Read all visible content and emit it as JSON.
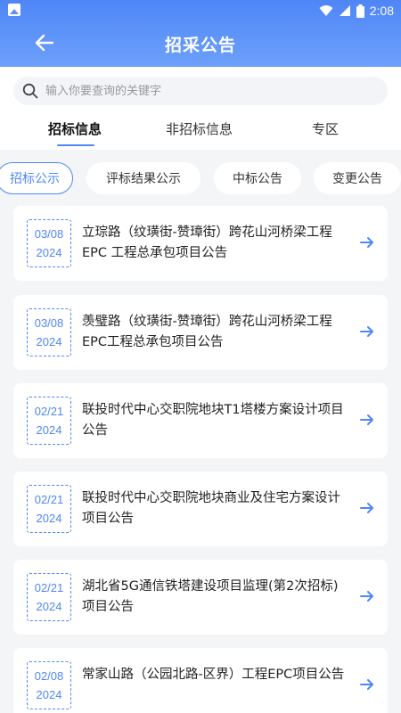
{
  "status_bar": {
    "time": "2:08"
  },
  "header": {
    "title": "招采公告"
  },
  "search": {
    "placeholder": "输入你要查询的关键字"
  },
  "tabs": [
    {
      "label": "招标信息",
      "active": true
    },
    {
      "label": "非招标信息",
      "active": false
    },
    {
      "label": "专区",
      "active": false
    }
  ],
  "chips": [
    {
      "label": "招标公示",
      "active": true
    },
    {
      "label": "评标结果公示",
      "active": false
    },
    {
      "label": "中标公告",
      "active": false
    },
    {
      "label": "变更公告",
      "active": false
    }
  ],
  "notices": [
    {
      "date": "03/08",
      "year": "2024",
      "title": "立琮路（纹璜街-赞璋街）跨花山河桥梁工程EPC 工程总承包项目公告"
    },
    {
      "date": "03/08",
      "year": "2024",
      "title": "羡璧路（纹璜街-赞璋街）跨花山河桥梁工程EPC工程总承包项目公告"
    },
    {
      "date": "02/21",
      "year": "2024",
      "title": "联投时代中心交职院地块T1塔楼方案设计项目公告"
    },
    {
      "date": "02/21",
      "year": "2024",
      "title": "联投时代中心交职院地块商业及住宅方案设计项目公告"
    },
    {
      "date": "02/21",
      "year": "2024",
      "title": "湖北省5G通信铁塔建设项目监理(第2次招标)项目公告"
    },
    {
      "date": "02/08",
      "year": "2024",
      "title": "常家山路（公园北路-区界）工程EPC项目公告"
    }
  ],
  "colors": {
    "primary": "#4f86f7",
    "background": "#f4f5f7"
  },
  "icons": [
    "image-icon",
    "wifi-icon",
    "signal-icon",
    "battery-icon",
    "back-arrow-icon",
    "search-icon",
    "arrow-right-icon"
  ]
}
